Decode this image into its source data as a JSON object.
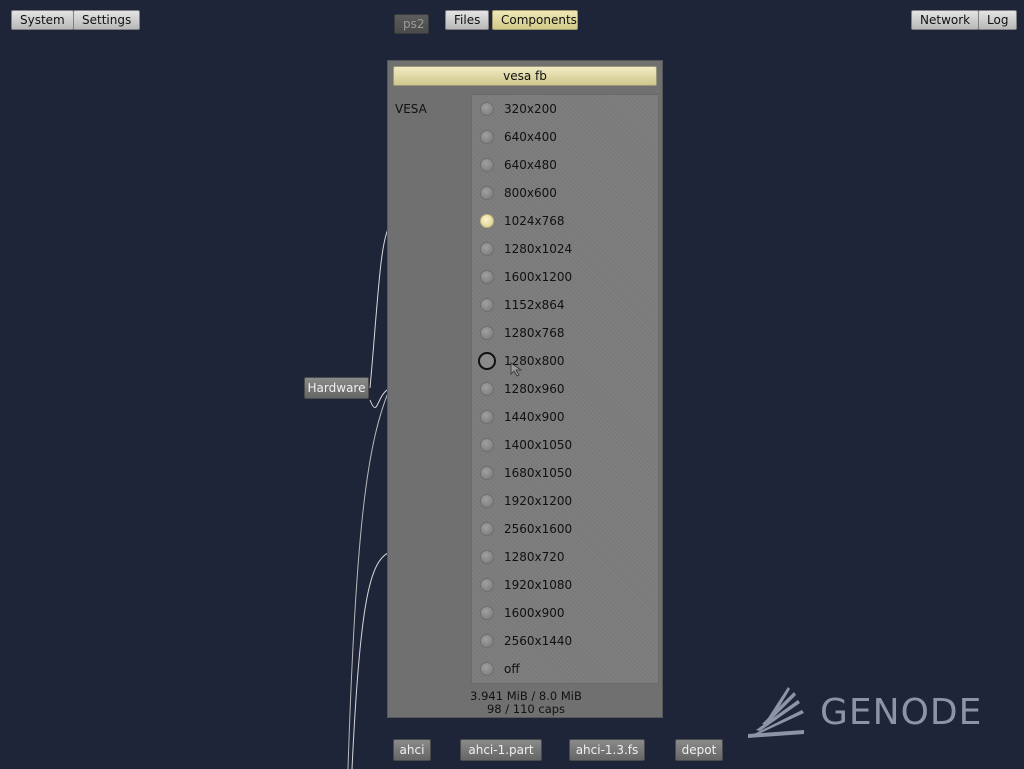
{
  "topbar": {
    "left": [
      "System",
      "Settings"
    ],
    "ps2": "ps2",
    "center": [
      "Files",
      "Components"
    ],
    "right": [
      "Network",
      "Log"
    ]
  },
  "graph": {
    "hardware_label": "Hardware",
    "bottom_nodes": [
      "ahci",
      "ahci-1.part",
      "ahci-1.3.fs",
      "depot"
    ]
  },
  "panel": {
    "title": "vesa fb",
    "label": "VESA",
    "selected": "1024x768",
    "modes": [
      "320x200",
      "640x400",
      "640x480",
      "800x600",
      "1024x768",
      "1280x1024",
      "1600x1200",
      "1152x864",
      "1280x768",
      "1280x800",
      "1280x960",
      "1440x900",
      "1400x1050",
      "1680x1050",
      "1920x1200",
      "2560x1600",
      "1280x720",
      "1920x1080",
      "1600x900",
      "2560x1440",
      "off"
    ],
    "stats_ram": "3.941 MiB / 8.0 MiB",
    "stats_caps": "98 / 110 caps"
  },
  "logo": {
    "text": "GENODE"
  },
  "colors": {
    "background": "#1f2538",
    "active": "#e4dca0",
    "panel": "#707070"
  }
}
